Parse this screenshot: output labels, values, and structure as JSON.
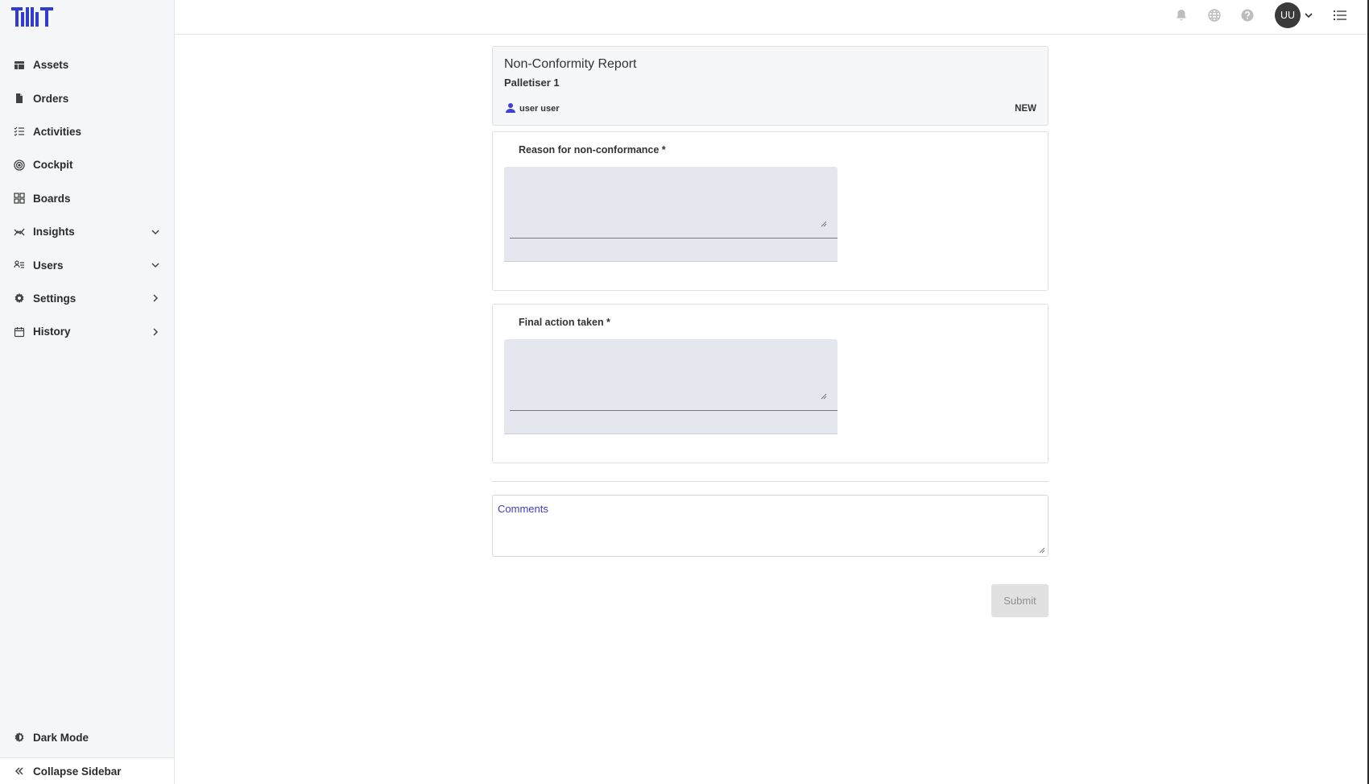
{
  "sidebar": {
    "items": [
      {
        "label": "Assets",
        "icon": "table-icon",
        "chevron": ""
      },
      {
        "label": "Orders",
        "icon": "file-icon",
        "chevron": ""
      },
      {
        "label": "Activities",
        "icon": "checklist-icon",
        "chevron": ""
      },
      {
        "label": "Cockpit",
        "icon": "target-icon",
        "chevron": ""
      },
      {
        "label": "Boards",
        "icon": "grid-icon",
        "chevron": ""
      },
      {
        "label": "Insights",
        "icon": "trend-icon",
        "chevron": "down"
      },
      {
        "label": "Users",
        "icon": "users-icon",
        "chevron": "down"
      },
      {
        "label": "Settings",
        "icon": "gear-icon",
        "chevron": "right"
      },
      {
        "label": "History",
        "icon": "calendar-icon",
        "chevron": "right"
      }
    ],
    "dark_mode_label": "Dark Mode",
    "collapse_label": "Collapse Sidebar"
  },
  "topbar": {
    "avatar_initials": "UU"
  },
  "report": {
    "title": "Non-Conformity Report",
    "subtitle": "Palletiser 1",
    "user": "user user",
    "status": "NEW"
  },
  "questions": [
    {
      "label": "Reason for non-conformance *",
      "value": ""
    },
    {
      "label": "Final action taken *",
      "value": ""
    }
  ],
  "comments": {
    "label": "Comments",
    "value": ""
  },
  "submit_label": "Submit",
  "colors": {
    "accent": "#3f3fd1",
    "sidebar_bg": "#f5f6f7",
    "field_bg": "#e4e7ed"
  }
}
